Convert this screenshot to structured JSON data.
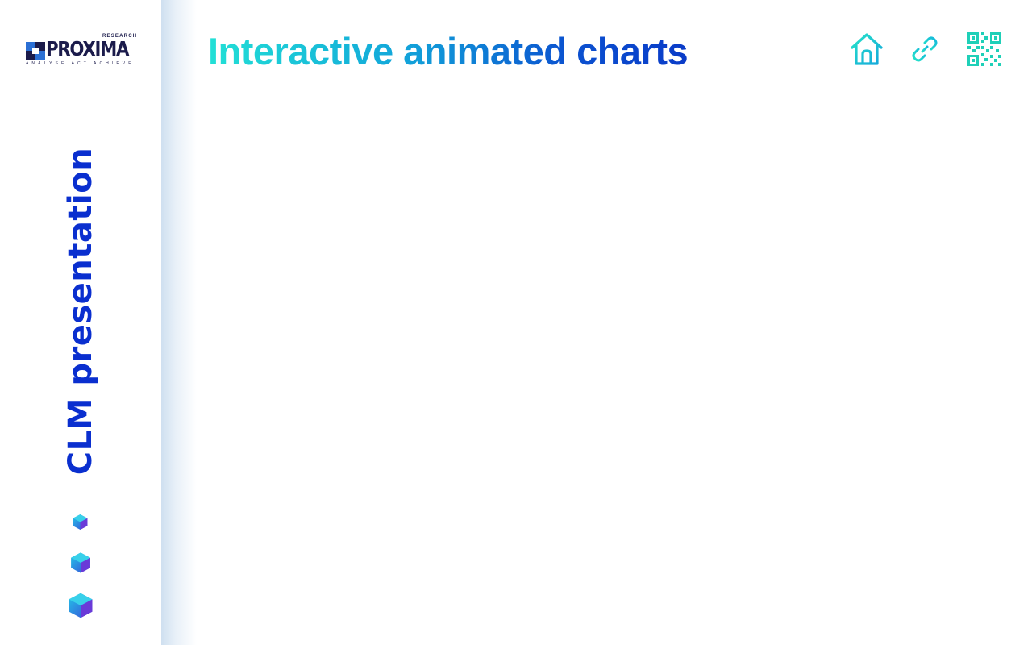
{
  "brand": {
    "name": "PROXIMA",
    "research": "RESEARCH",
    "tagline": "ANALYSE  ACT  ACHIEVE"
  },
  "sidebar": {
    "title": "CLM presentation",
    "decorations": [
      "cube-small-icon",
      "cube-medium-icon",
      "cube-large-icon"
    ]
  },
  "header": {
    "title": "Interactive animated charts",
    "icons": [
      "home-icon",
      "link-icon",
      "qr-code-icon"
    ]
  },
  "colors": {
    "accent_blue": "#0a2fcf",
    "gradient_start": "#22e0d6",
    "gradient_end": "#0a3bc8",
    "logo_dark": "#1b1b4b",
    "icon_teal": "#1fd8cf"
  }
}
